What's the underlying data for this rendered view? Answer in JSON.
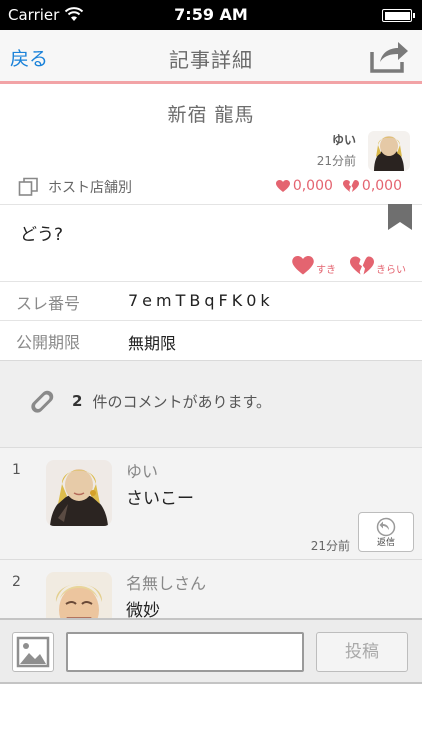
{
  "status_bar": {
    "carrier": "Carrier",
    "time": "7:59 AM"
  },
  "nav": {
    "back_label": "戻る",
    "title": "記事詳細",
    "share_icon": "share-icon"
  },
  "post": {
    "title": "新宿 龍馬",
    "author": "ゆい",
    "posted_ago": "21分前",
    "category": "ホスト店舗別",
    "like_count": "0,000",
    "dislike_count": "0,000",
    "body": "どう?",
    "like_label": "すき",
    "dislike_label": "きらい"
  },
  "meta": [
    {
      "key": "スレ番号",
      "value": "7emTBqFK0k"
    },
    {
      "key": "公開期限",
      "value": "無期限"
    }
  ],
  "comments_summary": {
    "count": "2",
    "text": "件のコメントがあります。"
  },
  "comments": [
    {
      "index": "1",
      "name": "ゆい",
      "text": "さいこー",
      "time": "21分前",
      "reply_label": "返信"
    },
    {
      "index": "2",
      "name": "名無しさん",
      "text": "微妙"
    }
  ],
  "compose": {
    "input_value": "",
    "post_label": "投稿"
  },
  "colors": {
    "accent_blue": "#1a82d9",
    "heart_pink": "#e46470",
    "nav_border": "#f2a3a6"
  }
}
